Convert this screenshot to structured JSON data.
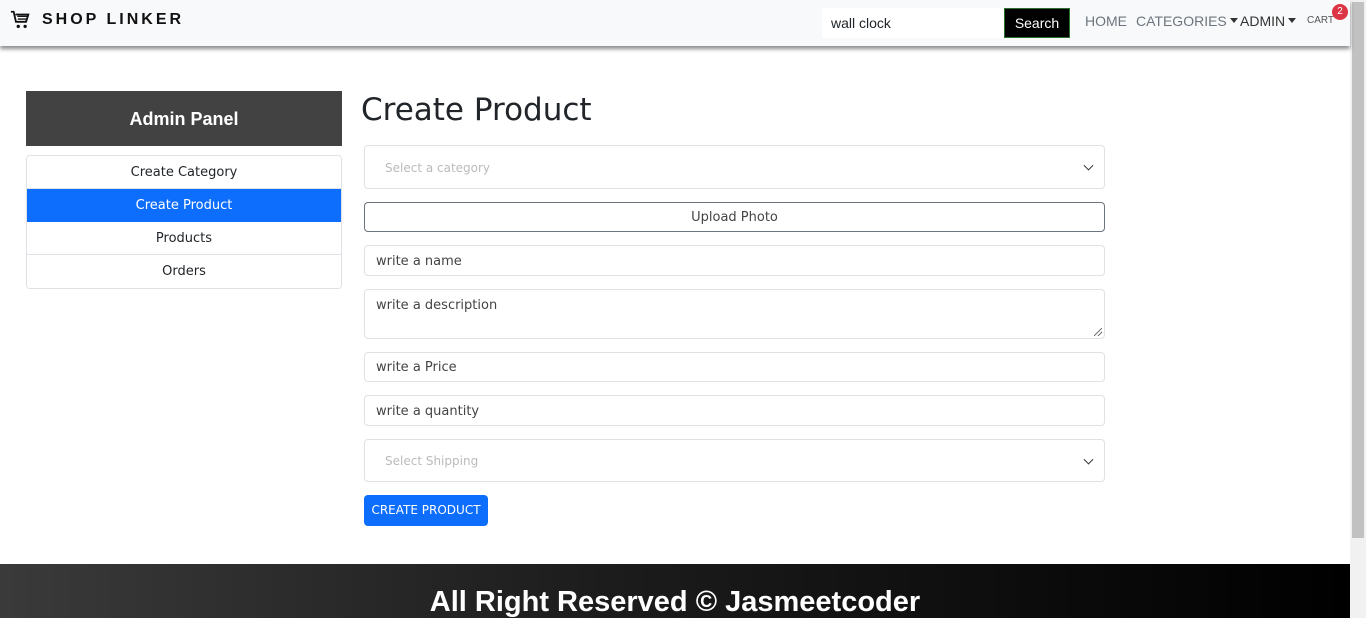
{
  "navbar": {
    "brand": "SHOP LINKER",
    "search_value": "wall clock",
    "search_button": "Search",
    "links": {
      "home": "HOME",
      "categories": "CATEGORIES",
      "admin": "ADMIN",
      "cart": "CART"
    },
    "cart_count": "2"
  },
  "sidebar": {
    "title": "Admin Panel",
    "items": [
      {
        "label": "Create Category"
      },
      {
        "label": "Create Product"
      },
      {
        "label": "Products"
      },
      {
        "label": "Orders"
      }
    ],
    "active_index": 1
  },
  "main": {
    "title": "Create Product",
    "category_placeholder": "Select a category",
    "upload_label": "Upload Photo",
    "name_placeholder": "write a name",
    "description_placeholder": "write a description",
    "price_placeholder": "write a Price",
    "quantity_placeholder": "write a quantity",
    "shipping_placeholder": "Select Shipping",
    "submit_label": "CREATE PRODUCT"
  },
  "footer": {
    "text": "All Right Reserved © Jasmeetcoder"
  },
  "colors": {
    "accent": "#0d6efd",
    "panel_header": "#424242",
    "badge": "#dc3545"
  }
}
